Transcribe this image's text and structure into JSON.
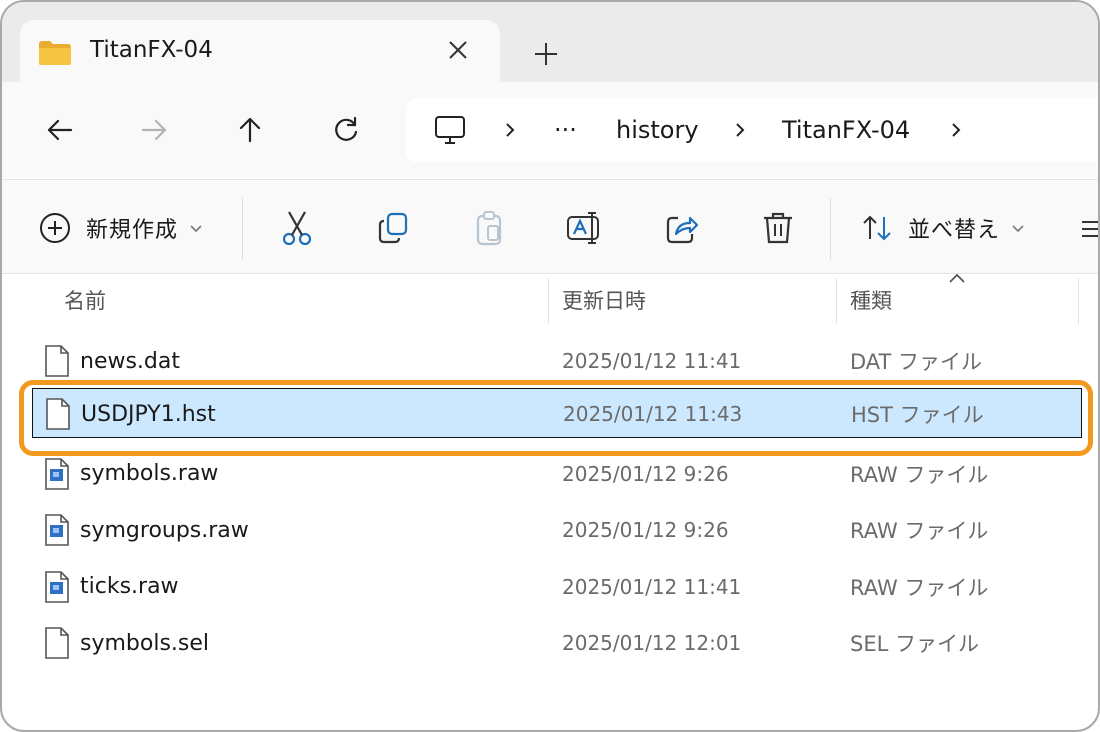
{
  "tab": {
    "title": "TitanFX-04"
  },
  "address": {
    "ellipsis": "···",
    "crumbs": [
      "history",
      "TitanFX-04"
    ]
  },
  "commands": {
    "new_label": "新規作成",
    "sort_label": "並べ替え"
  },
  "columns": {
    "name": "名前",
    "modified": "更新日時",
    "type": "種類"
  },
  "files": [
    {
      "name": "news.dat",
      "modified": "2025/01/12 11:41",
      "type": "DAT ファイル",
      "icon": "document-icon",
      "selected": false
    },
    {
      "name": "USDJPY1.hst",
      "modified": "2025/01/12 11:43",
      "type": "HST ファイル",
      "icon": "document-icon",
      "selected": true
    },
    {
      "name": "symbols.raw",
      "modified": "2025/01/12 9:26",
      "type": "RAW ファイル",
      "icon": "raw-file-icon",
      "selected": false
    },
    {
      "name": "symgroups.raw",
      "modified": "2025/01/12 9:26",
      "type": "RAW ファイル",
      "icon": "raw-file-icon",
      "selected": false
    },
    {
      "name": "ticks.raw",
      "modified": "2025/01/12 11:41",
      "type": "RAW ファイル",
      "icon": "raw-file-icon",
      "selected": false
    },
    {
      "name": "symbols.sel",
      "modified": "2025/01/12 12:01",
      "type": "SEL ファイル",
      "icon": "document-icon",
      "selected": false
    }
  ],
  "colors": {
    "highlight": "#f29a1f",
    "selection": "#cce8ff",
    "folder": "#f6c443"
  }
}
